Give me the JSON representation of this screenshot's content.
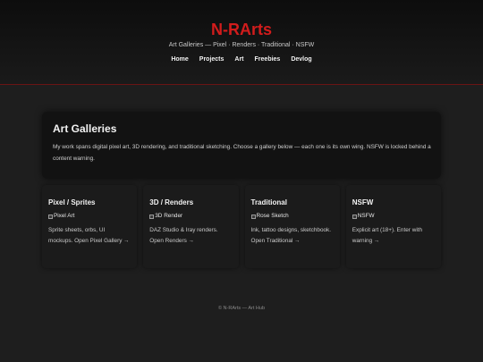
{
  "header": {
    "title": "N-RArts",
    "tagline": "Art Galleries — Pixel · Renders · Traditional · NSFW",
    "nav": [
      "Home",
      "Projects",
      "Art",
      "Freebies",
      "Devlog"
    ]
  },
  "intro": {
    "title": "Art Galleries",
    "text": "My work spans digital pixel art, 3D rendering, and traditional sketching. Choose a gallery below — each one is its own wing. NSFW is locked behind a content warning."
  },
  "galleries": [
    {
      "title": "Pixel / Sprites",
      "image_alt": "Pixel Art",
      "description": "Sprite sheets, orbs, UI mockups. Open Pixel Gallery →"
    },
    {
      "title": "3D / Renders",
      "image_alt": "3D Render",
      "description": "DAZ Studio & Iray renders. Open Renders →"
    },
    {
      "title": "Traditional",
      "image_alt": "Rose Sketch",
      "description": "Ink, tattoo designs, sketchbook. Open Traditional →"
    },
    {
      "title": "NSFW",
      "image_alt": "NSFW",
      "description": "Explicit art (18+). Enter with warning →"
    }
  ],
  "footer": {
    "text": "© N-RArts — Art Hub"
  },
  "colors": {
    "accent": "#d21c1c",
    "background": "#1e1e1e",
    "card": "#1b1b1b"
  }
}
